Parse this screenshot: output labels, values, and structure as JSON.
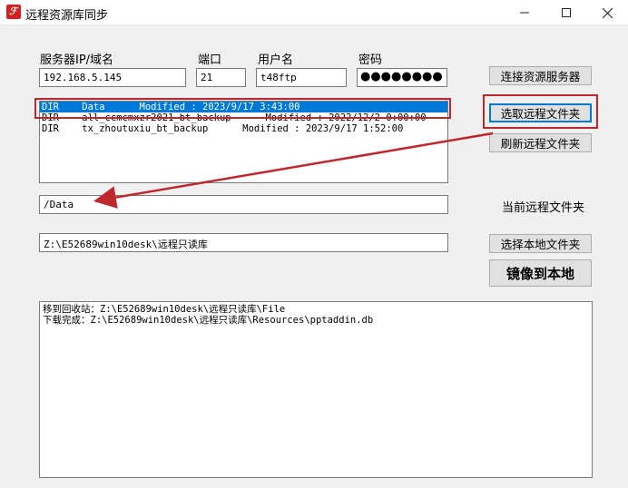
{
  "window": {
    "title": "远程资源库同步",
    "icon_color": "#d81e1e"
  },
  "labels": {
    "server": "服务器IP/域名",
    "port": "端口",
    "username": "用户名",
    "password": "密码",
    "current_remote": "当前远程文件夹"
  },
  "fields": {
    "server": "192.168.5.145",
    "port": "21",
    "username": "t48ftp",
    "password": "●●●●●●●●",
    "remote_path": "/Data",
    "local_path": "Z:\\E52689win10desk\\远程只读库"
  },
  "buttons": {
    "connect": "连接资源服务器",
    "select_remote": "选取远程文件夹",
    "refresh_remote": "刷新远程文件夹",
    "select_local": "选择本地文件夹",
    "mirror": "镜像到本地"
  },
  "remote_list": [
    {
      "type": "DIR",
      "name": "Data",
      "modified": "Modified : 2023/9/17 3:43:00",
      "selected": true
    },
    {
      "type": "DIR",
      "name": "all_ccmcmxzr2021_bt_backup",
      "modified": "Modified : 2022/12/2 0:00:00",
      "selected": false
    },
    {
      "type": "DIR",
      "name": "tx_zhoutuxiu_bt_backup",
      "modified": "Modified : 2023/9/17 1:52:00",
      "selected": false
    }
  ],
  "log": [
    "移到回收站：Z:\\E52689win10desk\\远程只读库\\File",
    "下载完成：Z:\\E52689win10desk\\远程只读库\\Resources\\pptaddin.db"
  ],
  "colors": {
    "selection": "#0078d7",
    "annotation": "#c0272d"
  }
}
